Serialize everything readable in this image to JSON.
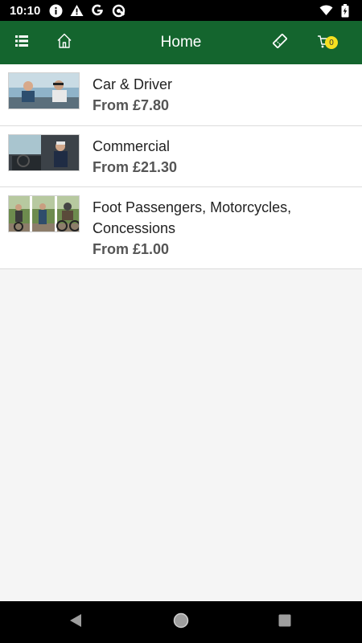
{
  "status_bar": {
    "time": "10:10",
    "icons": [
      "info-icon",
      "warning-icon",
      "google-icon",
      "sync-icon",
      "wifi-icon",
      "battery-icon"
    ]
  },
  "app_bar": {
    "title": "Home",
    "cart_count": "0",
    "background_color": "#14652e",
    "badge_color": "#f5e020",
    "icons": [
      "menu-icon",
      "home-icon",
      "ticket-icon",
      "cart-icon"
    ]
  },
  "products": [
    {
      "name": "Car & Driver",
      "price": "From £7.80",
      "image": "car-driver-photo"
    },
    {
      "name": "Commercial",
      "price": "From £21.30",
      "image": "commercial-van-photo"
    },
    {
      "name": "Foot Passengers, Motorcycles, Concessions",
      "price": "From £1.00",
      "image": "passengers-motorcycles-photo"
    }
  ],
  "nav_bar": {
    "icons": [
      "back-icon",
      "home-circle-icon",
      "recents-icon"
    ]
  }
}
